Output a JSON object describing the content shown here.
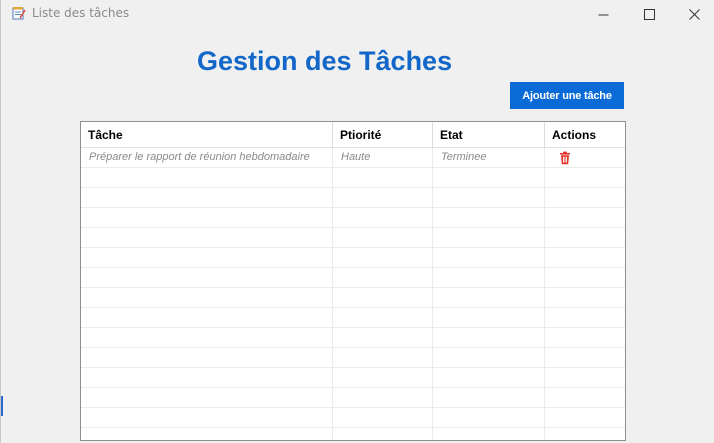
{
  "window": {
    "title": "Liste des tâches",
    "icon": "notepad-checklist-icon"
  },
  "page": {
    "heading": "Gestion des Tâches",
    "add_button_label": "Ajouter une tâche"
  },
  "table": {
    "columns": [
      "Tâche",
      "Ptiorité",
      "Etat",
      "Actions"
    ],
    "rows": [
      {
        "task": "Préparer le rapport de réunion hebdomadaire",
        "priority": "Haute",
        "status": "Terminee",
        "action_icon": "trash-icon"
      }
    ],
    "empty_row_count": 14
  },
  "colors": {
    "heading": "#1367c8",
    "button": "#0a6bd6",
    "delete_icon": "#e0332b"
  }
}
